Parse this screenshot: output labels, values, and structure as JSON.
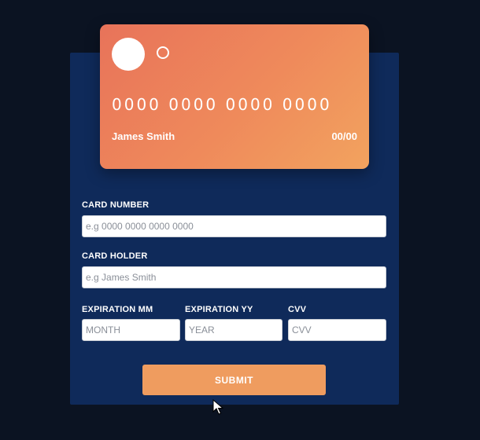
{
  "card": {
    "number": "0000 0000 0000 0000",
    "holder": "James Smith",
    "expiry": "00/00"
  },
  "form": {
    "card_number": {
      "label": "CARD NUMBER",
      "placeholder": "e.g 0000 0000 0000 0000"
    },
    "card_holder": {
      "label": "CARD HOLDER",
      "placeholder": "e.g James Smith"
    },
    "exp_mm": {
      "label": "EXPIRATION MM",
      "placeholder": "MONTH"
    },
    "exp_yy": {
      "label": "EXPIRATION YY",
      "placeholder": "YEAR"
    },
    "cvv": {
      "label": "CVV",
      "placeholder": "CVV"
    },
    "submit_label": "SUBMIT"
  },
  "icons": {
    "cursor": "mouse-pointer-icon"
  },
  "colors": {
    "background": "#0b1322",
    "panel": "#0f2a5a",
    "card_gradient_start": "#e8735a",
    "card_gradient_end": "#f2a35f",
    "button": "#ef9c5f"
  }
}
